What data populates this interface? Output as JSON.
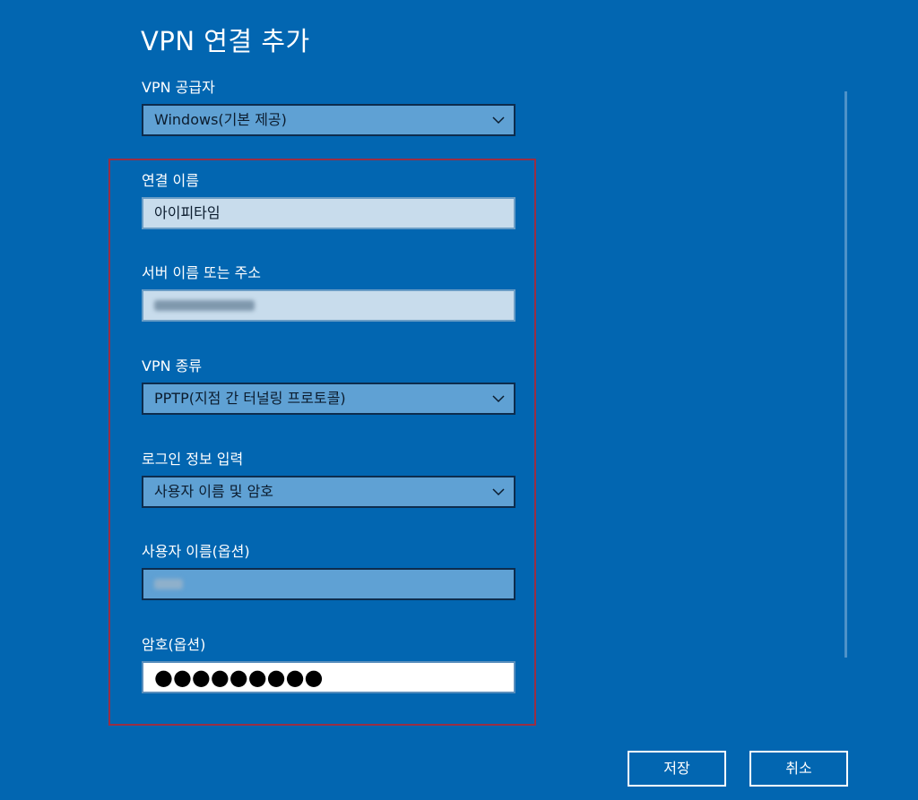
{
  "dialog": {
    "title": "VPN 연결 추가"
  },
  "fields": {
    "provider": {
      "label": "VPN 공급자",
      "value": "Windows(기본 제공)"
    },
    "connection_name": {
      "label": "연결 이름",
      "value": "아이피타임"
    },
    "server": {
      "label": "서버 이름 또는 주소"
    },
    "vpn_type": {
      "label": "VPN 종류",
      "value": "PPTP(지점 간 터널링 프로토콜)"
    },
    "signin_type": {
      "label": "로그인 정보 입력",
      "value": "사용자 이름 및 암호"
    },
    "username": {
      "label": "사용자 이름(옵션)"
    },
    "password": {
      "label": "암호(옵션)",
      "value": "●●●●●●●●●"
    }
  },
  "buttons": {
    "save": "저장",
    "cancel": "취소"
  },
  "colors": {
    "background": "#0266b1",
    "highlight_border": "#9b2e43",
    "dropdown_fill": "#5fa1d4",
    "text_input_fill": "#c8dcec"
  },
  "icons": {
    "dropdown": "chevron-down-icon"
  }
}
